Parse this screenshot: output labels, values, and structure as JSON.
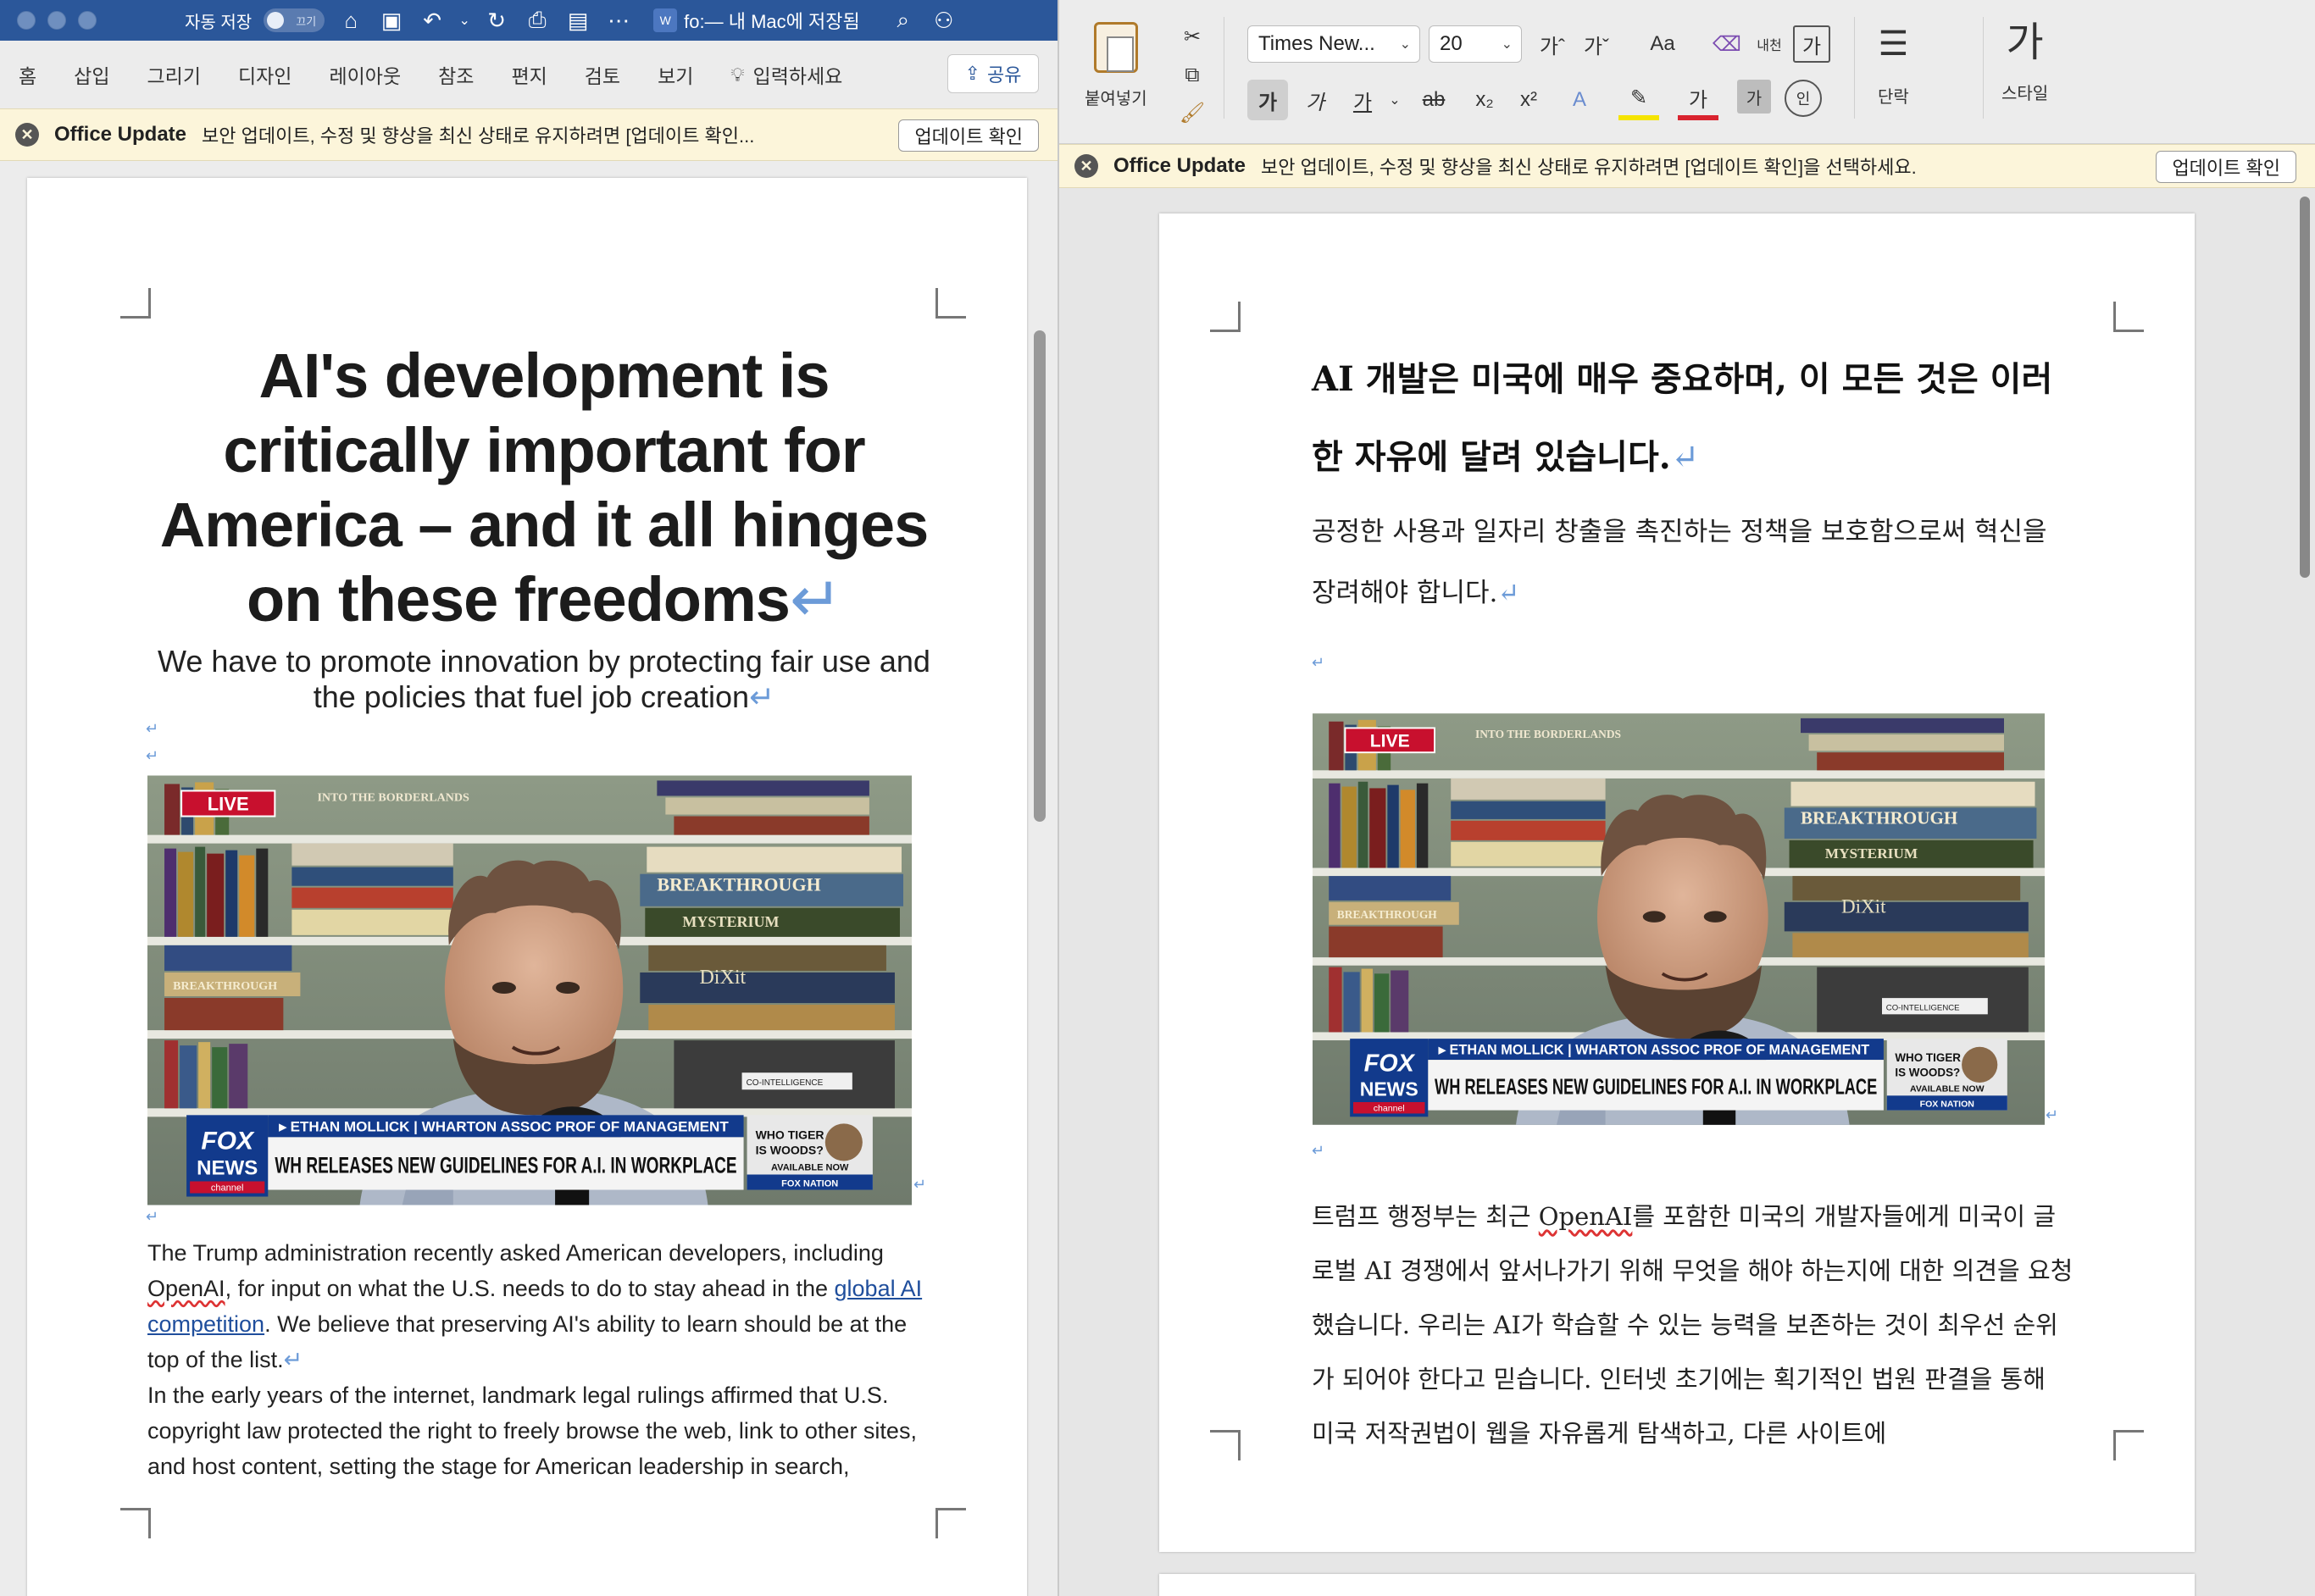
{
  "left_window": {
    "titlebar": {
      "autosave_label": "자동 저장",
      "toggle_state": "끄기",
      "doc_title": "fo:— 내 Mac에 저장됨",
      "doc_icon_letter": "W"
    },
    "tabs": [
      "홈",
      "삽입",
      "그리기",
      "디자인",
      "레이아웃",
      "참조",
      "편지",
      "검토",
      "보기"
    ],
    "tell_me": "입력하세요",
    "share_label": "공유",
    "message_bar": {
      "title": "Office Update",
      "text": "보안 업데이트, 수정 및 향상을 최신 상태로 유지하려면 [업데이트 확인...",
      "button": "업데이트 확인"
    },
    "document": {
      "headline": "AI's development is critically important for America – and it all hinges on these freedoms",
      "subhead": "We have to promote innovation by protecting fair use and the policies that fuel job creation",
      "body_p1_a": "The Trump administration recently asked American developers, including ",
      "body_p1_openai": "OpenAI",
      "body_p1_b": ", for input on what the U.S. needs to do to stay ahead in the ",
      "body_p1_link": "global AI competition",
      "body_p1_c": ". We believe that preserving AI's ability to learn should be at the top of the list.",
      "body_p2": "In the early years of the internet, landmark legal rulings affirmed that U.S. copyright law protected the right to freely browse the web, link to other sites, and host content, setting the stage for American leadership in search,"
    }
  },
  "right_window": {
    "ribbon": {
      "paste_label": "붙여넣기",
      "font_name": "Times New...",
      "font_size": "20",
      "grow_font": "가ˆ",
      "shrink_font": "가ˇ",
      "change_case": "Aa",
      "bold": "가",
      "italic": "가",
      "underline": "가",
      "strike": "ab",
      "subscript": "x₂",
      "superscript": "x²",
      "font_color_label": "가",
      "char_shading": "가",
      "paragraph_label": "단락",
      "styles_label": "스타일",
      "phonetic": "내천",
      "char_border": "가"
    },
    "message_bar": {
      "title": "Office Update",
      "text": "보안 업데이트, 수정 및 향상을 최신 상태로 유지하려면 [업데이트 확인]을 선택하세요.",
      "button": "업데이트 확인"
    },
    "document": {
      "headline": "AI 개발은 미국에 매우 중요하며, 이 모든 것은 이러한 자유에 달려 있습니다.",
      "subhead": "공정한 사용과 일자리 창출을 촉진하는 정책을 보호함으로써 혁신을 장려해야 합니다.",
      "body_a": "트럼프 행정부는 최근 ",
      "body_openai": "OpenAI",
      "body_b": "를 포함한 미국의 개발자들에게 미국이 글로벌 AI 경쟁에서 앞서나가기 위해 무엇을 해야 하는지에 대한 의견을 요청했습니다. 우리는 AI가 학습할 수 있는 능력을 보존하는 것이 최우선 순위가 되어야 한다고 믿습니다. 인터넷 초기에는 획기적인 법원 판결을 통해 미국 저작권법이 웹을 자유롭게 탐색하고, 다른 사이트에"
    }
  },
  "news_image": {
    "live_badge": "LIVE",
    "network": "FOX NEWS",
    "network_sub": "channel",
    "name_bar": "ETHAN MOLLICK | WHARTON ASSOC PROF OF MANAGEMENT",
    "headline": "WH RELEASES NEW GUIDELINES FOR A.I. IN WORKPLACE",
    "promo_line1": "WHO TIGER",
    "promo_line2": "IS WOODS?",
    "promo_avail": "AVAILABLE NOW",
    "promo_brand": "FOX NATION",
    "shelf_books": [
      "INTO THE BORDERLANDS",
      "BREAKTHROUGH",
      "MYSTERIUM",
      "DiXit",
      "BREAKTHROUGH",
      "CO-INTELLIGENCE"
    ]
  },
  "colors": {
    "word_blue": "#2b579a",
    "message_bar_bg": "#fcf5da",
    "fox_red": "#c8102e",
    "fox_blue": "#123a8c"
  }
}
